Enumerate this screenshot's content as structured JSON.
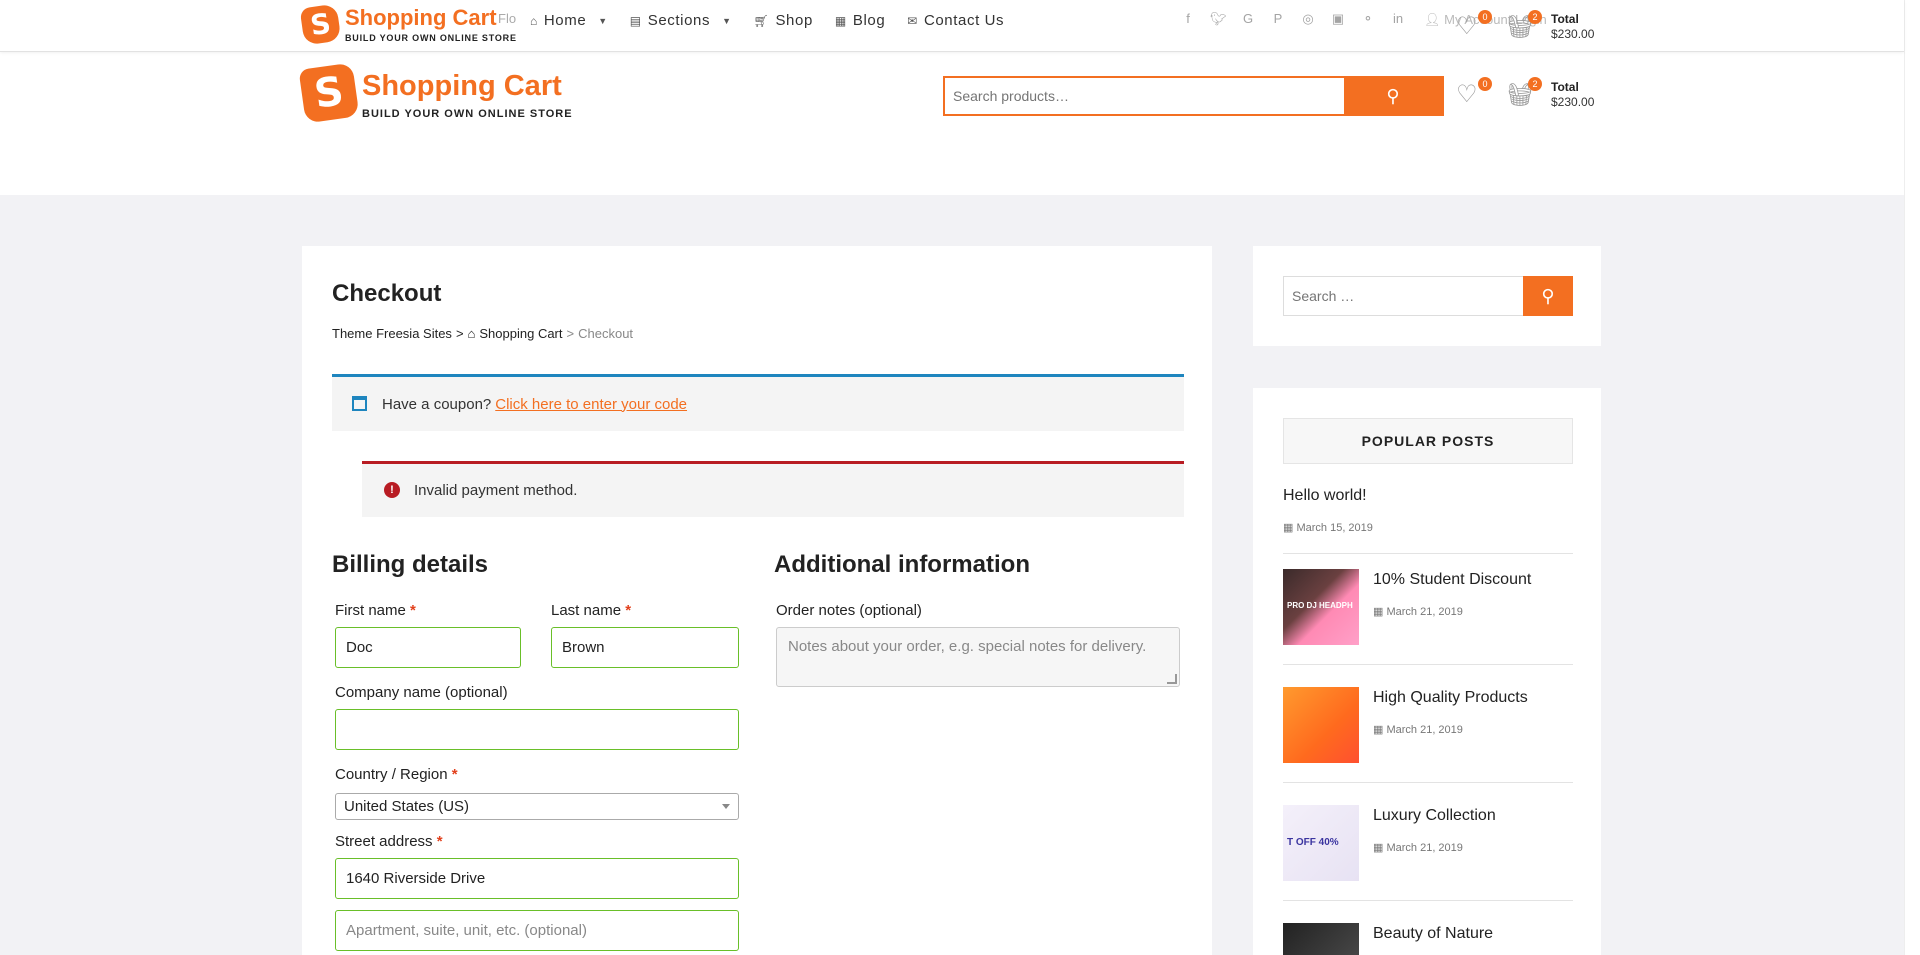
{
  "brand": {
    "title": "Shopping Cart",
    "tagline": "BUILD YOUR OWN ONLINE STORE",
    "logo_letter": "S",
    "accent_color": "#f36f21"
  },
  "sticky_header": {
    "behind_text": "Flo",
    "nav": [
      {
        "label": "Home",
        "icon": "home-icon",
        "has_dropdown": true
      },
      {
        "label": "Sections",
        "icon": "sections-icon",
        "has_dropdown": true
      },
      {
        "label": "Shop",
        "icon": "cart-icon",
        "has_dropdown": false
      },
      {
        "label": "Blog",
        "icon": "blog-icon",
        "has_dropdown": false
      },
      {
        "label": "Contact Us",
        "icon": "mail-icon",
        "has_dropdown": false
      }
    ],
    "socials": [
      "facebook-icon",
      "twitter-icon",
      "google-plus-icon",
      "pinterest-icon",
      "dribbble-icon",
      "instagram-icon",
      "flickr-icon",
      "linkedin-icon"
    ],
    "my_account": "My Account",
    "login": "Login"
  },
  "header": {
    "search_placeholder": "Search products…",
    "wishlist_count": "0",
    "cart_count": "2",
    "total_label": "Total",
    "total_value": "$230.00"
  },
  "page": {
    "title": "Checkout",
    "breadcrumb": {
      "root": "Theme Freesia Sites",
      "parent": "Shopping Cart",
      "current": "Checkout",
      "sep": ">"
    },
    "coupon": {
      "text": "Have a coupon?",
      "link": "Click here to enter your code"
    },
    "error": "Invalid payment method.",
    "billing": {
      "heading": "Billing details",
      "first_name_label": "First name",
      "first_name_value": "Doc",
      "last_name_label": "Last name",
      "last_name_value": "Brown",
      "company_label": "Company name (optional)",
      "company_value": "",
      "country_label": "Country / Region",
      "country_value": "United States (US)",
      "street_label": "Street address",
      "street_value": "1640 Riverside Drive",
      "apartment_placeholder": "Apartment, suite, unit, etc. (optional)",
      "required_mark": "*"
    },
    "additional": {
      "heading": "Additional information",
      "notes_label": "Order notes (optional)",
      "notes_placeholder": "Notes about your order, e.g. special notes for delivery."
    }
  },
  "sidebar": {
    "search_placeholder": "Search …",
    "popular_title": "POPULAR POSTS",
    "posts": [
      {
        "title": "Hello world!",
        "date": "March 15, 2019",
        "thumb": ""
      },
      {
        "title": "10% Student Discount",
        "date": "March 21, 2019",
        "thumb": "PRO DJ HEADPH"
      },
      {
        "title": "High Quality Products",
        "date": "March 21, 2019",
        "thumb": ""
      },
      {
        "title": "Luxury Collection",
        "date": "March 21, 2019",
        "thumb": "T OFF 40%"
      },
      {
        "title": "Beauty of Nature",
        "date": "",
        "thumb": ""
      }
    ]
  }
}
